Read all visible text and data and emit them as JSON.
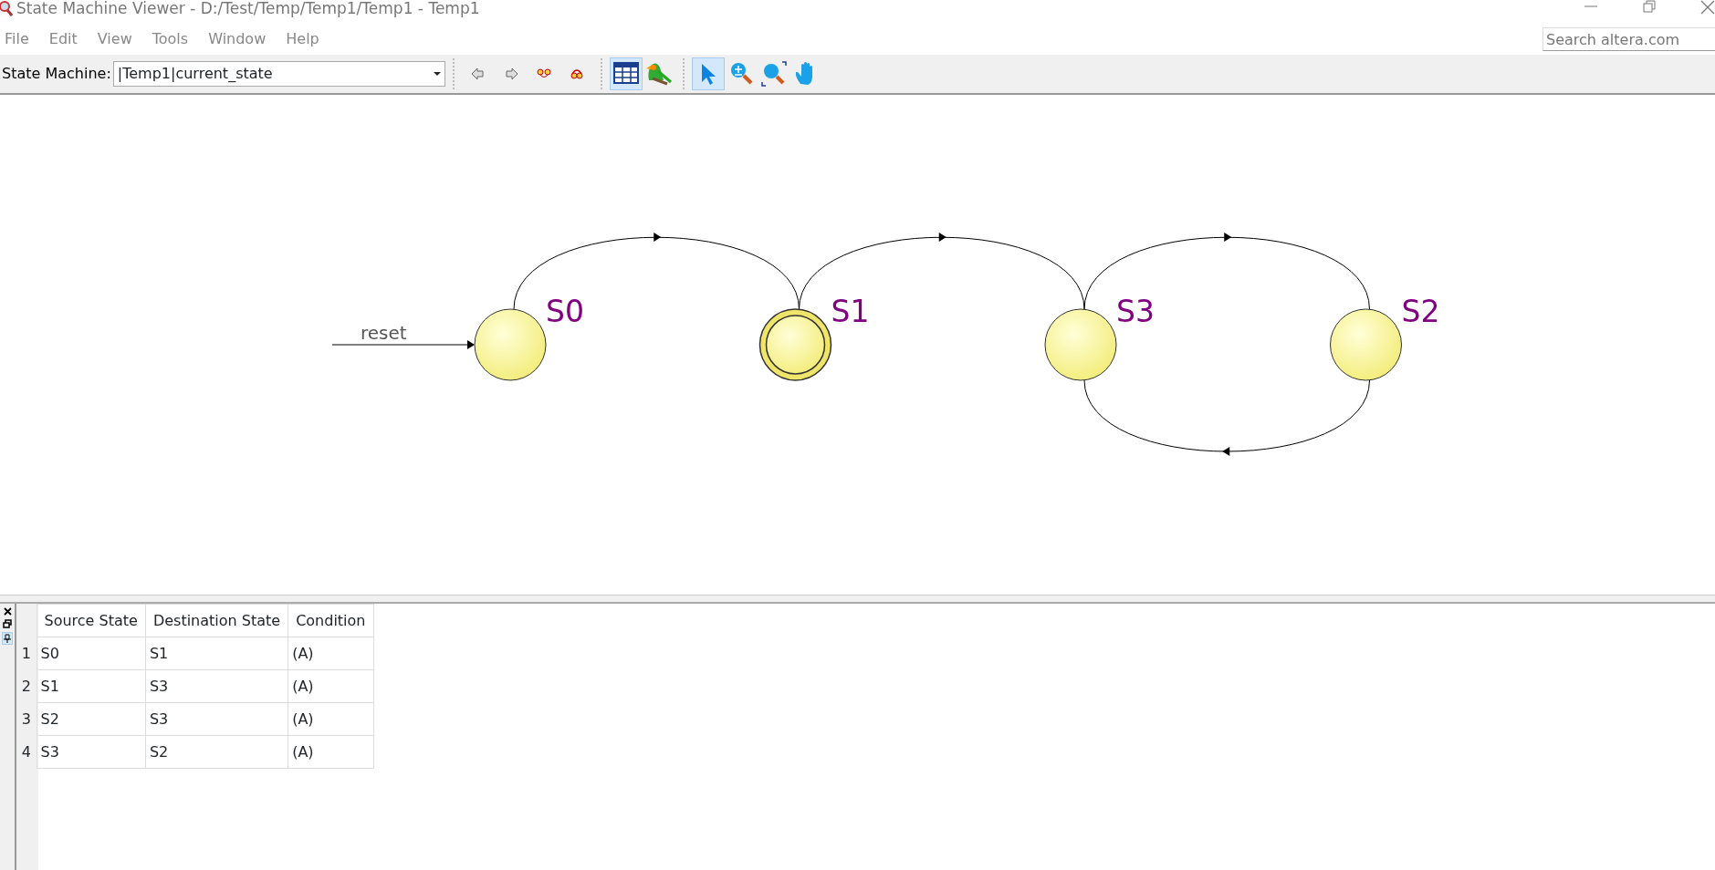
{
  "window": {
    "title": "State Machine Viewer - D:/Test/Temp/Temp1/Temp1 - Temp1"
  },
  "menu": [
    "File",
    "Edit",
    "View",
    "Tools",
    "Window",
    "Help"
  ],
  "search": {
    "placeholder": "Search altera.com"
  },
  "toolbar": {
    "label": "State Machine:",
    "machine_select": {
      "value": "|Temp1|current_state"
    },
    "button_groups": [
      [
        {
          "kind": "back",
          "selected": false
        },
        {
          "kind": "forward",
          "selected": false
        },
        {
          "kind": "nodes",
          "selected": false
        },
        {
          "kind": "loop",
          "selected": false
        }
      ],
      [
        {
          "kind": "table",
          "selected": true
        },
        {
          "kind": "bird",
          "selected": false
        }
      ],
      [
        {
          "kind": "pointer",
          "selected": true
        },
        {
          "kind": "zoom_in",
          "selected": false
        },
        {
          "kind": "zoom_fit",
          "selected": false
        },
        {
          "kind": "hand",
          "selected": false
        }
      ]
    ]
  },
  "diagram": {
    "reset": {
      "label": "reset"
    },
    "states": [
      {
        "name": "S0",
        "selected": false
      },
      {
        "name": "S1",
        "selected": true
      },
      {
        "name": "S3",
        "selected": false
      },
      {
        "name": "S2",
        "selected": false
      }
    ],
    "transitions": [
      {
        "kind": "forward"
      },
      {
        "kind": "forward"
      },
      {
        "kind": "forward"
      },
      {
        "kind": "backward"
      }
    ]
  },
  "table": {
    "columns": [
      "Source State",
      "Destination State",
      "Condition"
    ],
    "rows": [
      {
        "number": "1",
        "cells": [
          "S0",
          "S1",
          "(A)"
        ]
      },
      {
        "number": "2",
        "cells": [
          "S1",
          "S3",
          "(A)"
        ]
      },
      {
        "number": "3",
        "cells": [
          "S2",
          "S3",
          "(A)"
        ]
      },
      {
        "number": "4",
        "cells": [
          "S3",
          "S2",
          "(A)"
        ]
      }
    ]
  }
}
